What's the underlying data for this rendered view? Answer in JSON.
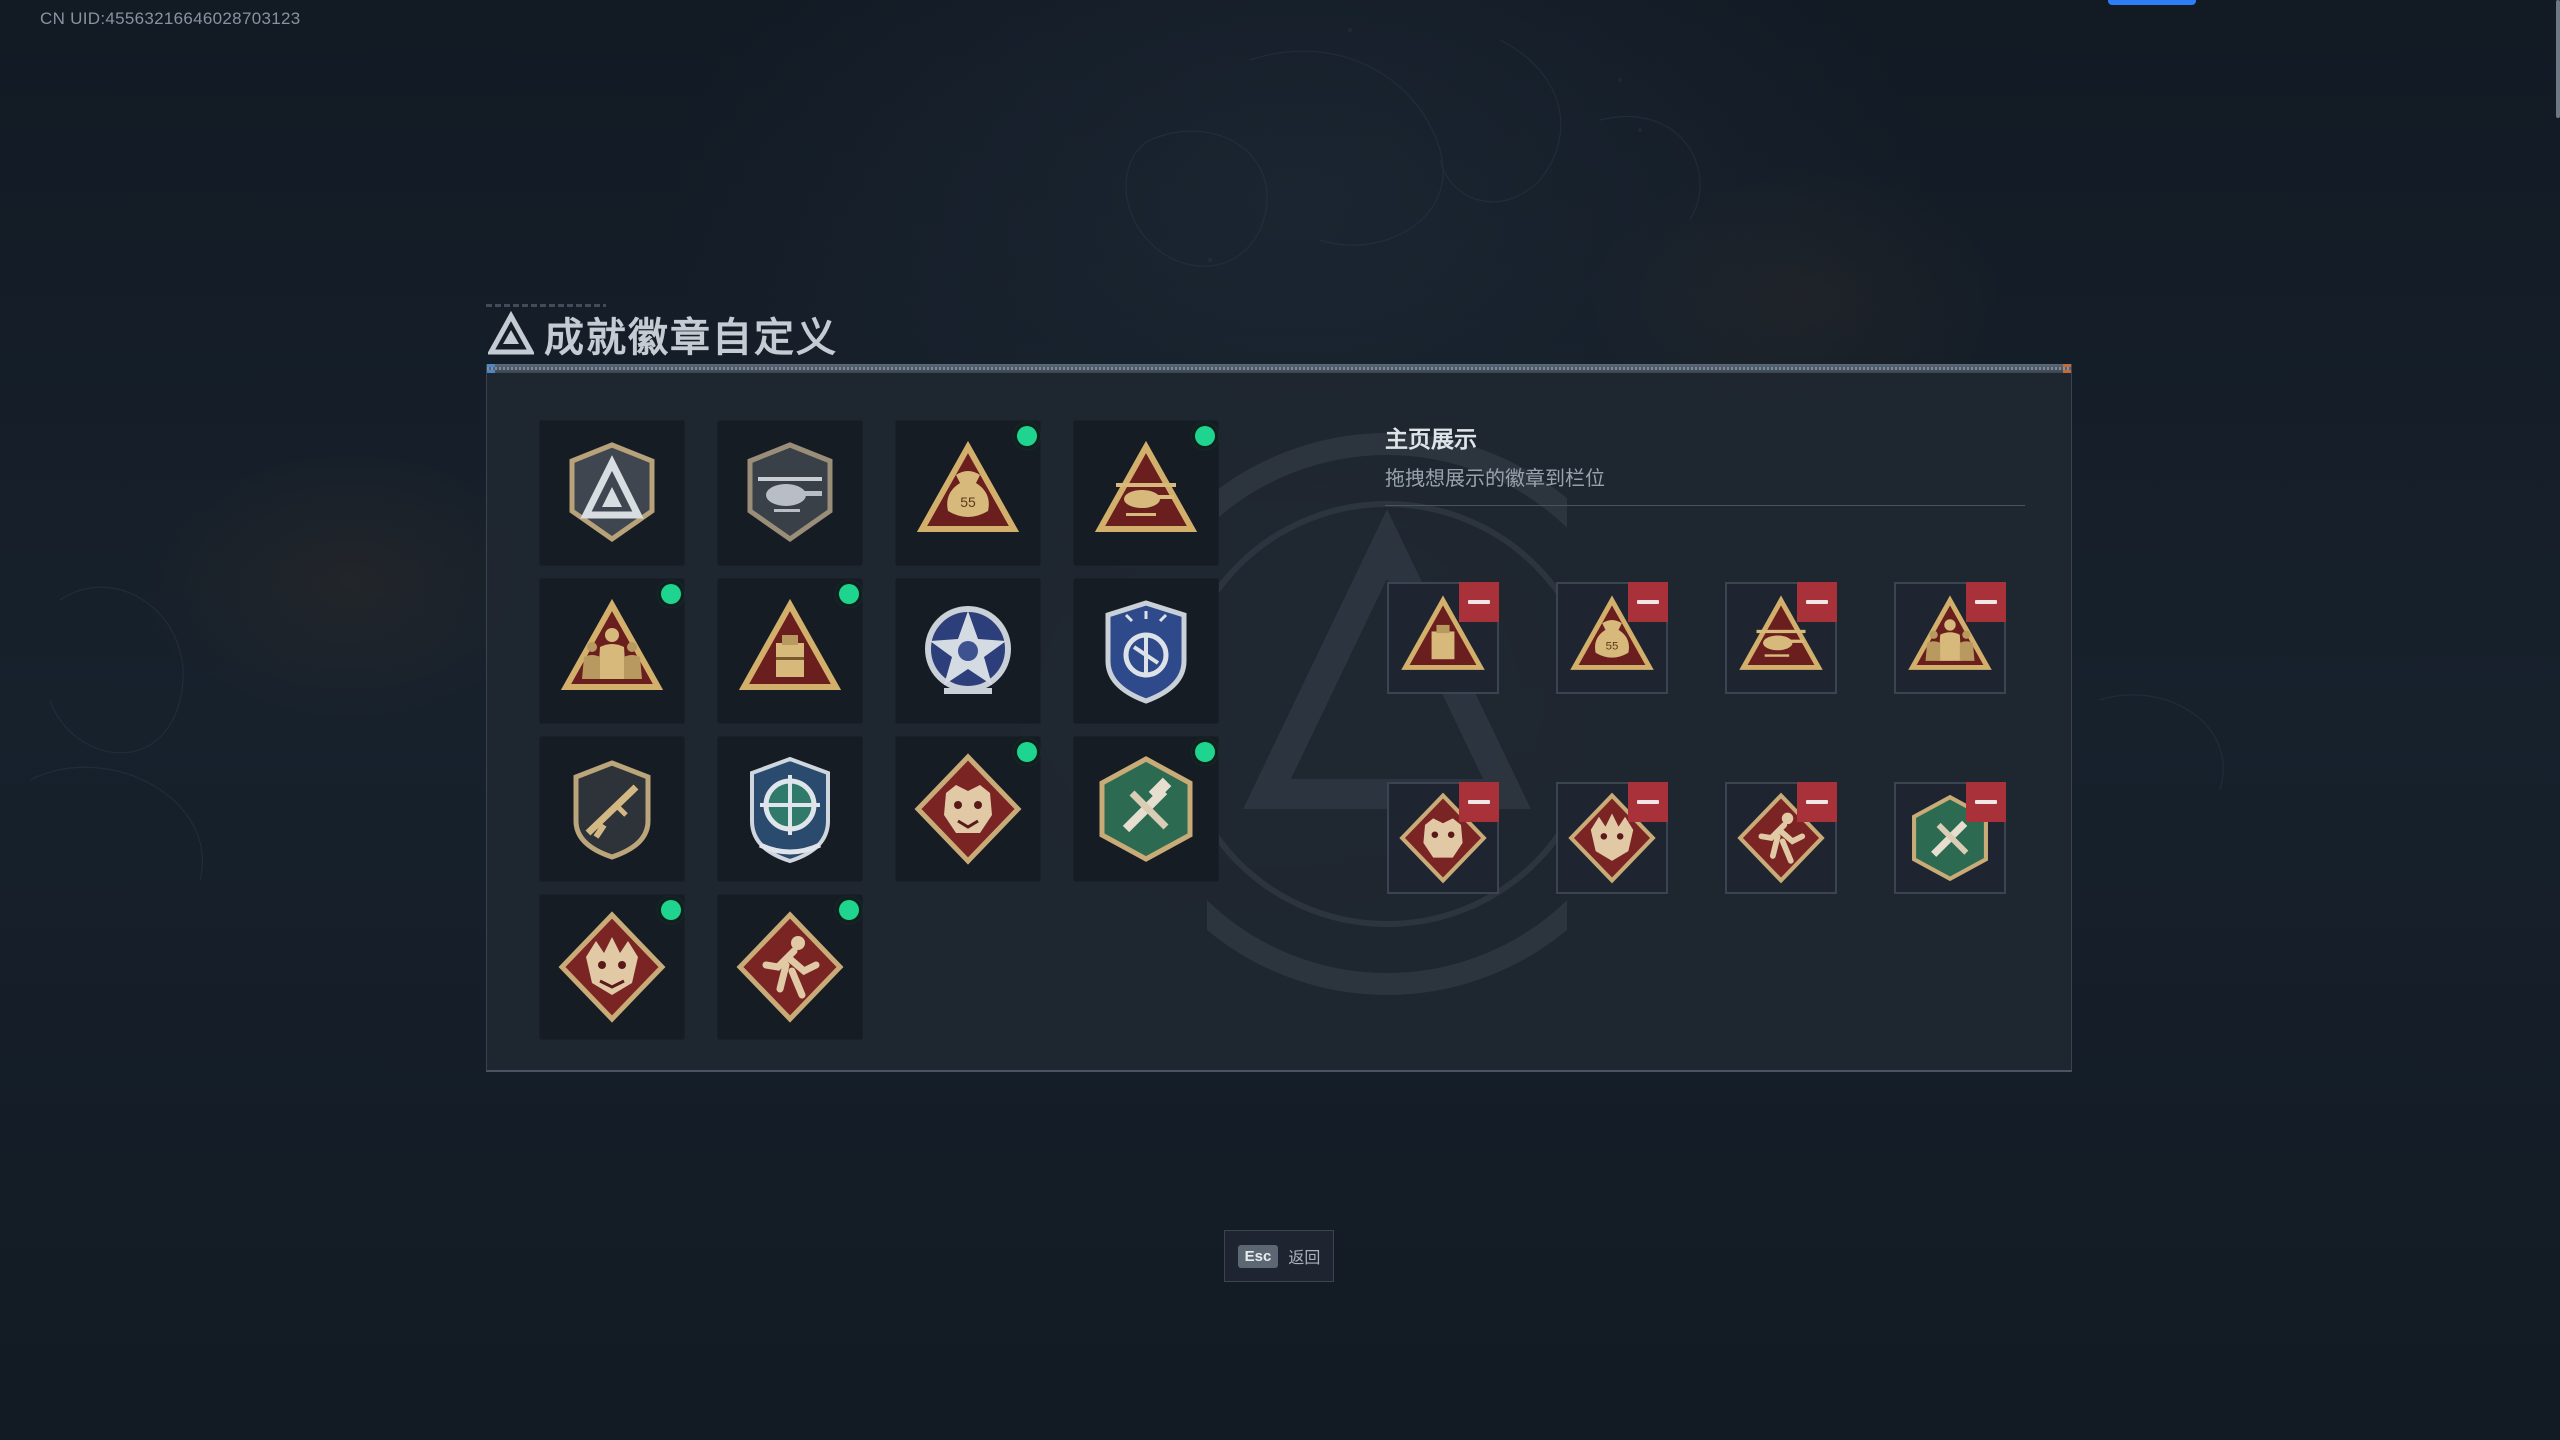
{
  "header": {
    "uid": "CN UID:4556321664602870312​3"
  },
  "title": "成就徽章自定义",
  "badges": [
    {
      "icon": "silver-shield-emblem-icon",
      "new": false
    },
    {
      "icon": "helicopter-shield-icon",
      "new": false
    },
    {
      "icon": "money-bag-triangle-icon",
      "new": true
    },
    {
      "icon": "helicopter-triangle-icon",
      "new": true
    },
    {
      "icon": "squad-triangle-icon",
      "new": true
    },
    {
      "icon": "supply-box-triangle-icon",
      "new": true
    },
    {
      "icon": "silver-star-emblem-icon",
      "new": false
    },
    {
      "icon": "blue-police-shield-icon",
      "new": false
    },
    {
      "icon": "rifle-shield-icon",
      "new": false
    },
    {
      "icon": "blue-crosshair-emblem-icon",
      "new": false
    },
    {
      "icon": "bear-diamond-icon",
      "new": true
    },
    {
      "icon": "green-tools-hexagon-icon",
      "new": true
    },
    {
      "icon": "dragon-diamond-icon",
      "new": true
    },
    {
      "icon": "runner-diamond-icon",
      "new": true
    }
  ],
  "display": {
    "title": "主页展示",
    "subtitle": "拖拽想展示的徽章到栏位",
    "slots": [
      {
        "icon": "supply-box-triangle-icon"
      },
      {
        "icon": "money-bag-triangle-icon"
      },
      {
        "icon": "helicopter-triangle-icon"
      },
      {
        "icon": "squad-triangle-icon"
      },
      {
        "icon": "bear-diamond-icon"
      },
      {
        "icon": "dragon-diamond-icon"
      },
      {
        "icon": "runner-diamond-icon"
      },
      {
        "icon": "green-tools-hexagon-icon"
      }
    ]
  },
  "footer": {
    "esc_key": "Esc",
    "esc_label": "返回"
  },
  "colors": {
    "new_dot": "#1fd48e",
    "remove": "#a8313a",
    "gold": "#c9a869",
    "accent_blue": "#2e7cf6"
  }
}
